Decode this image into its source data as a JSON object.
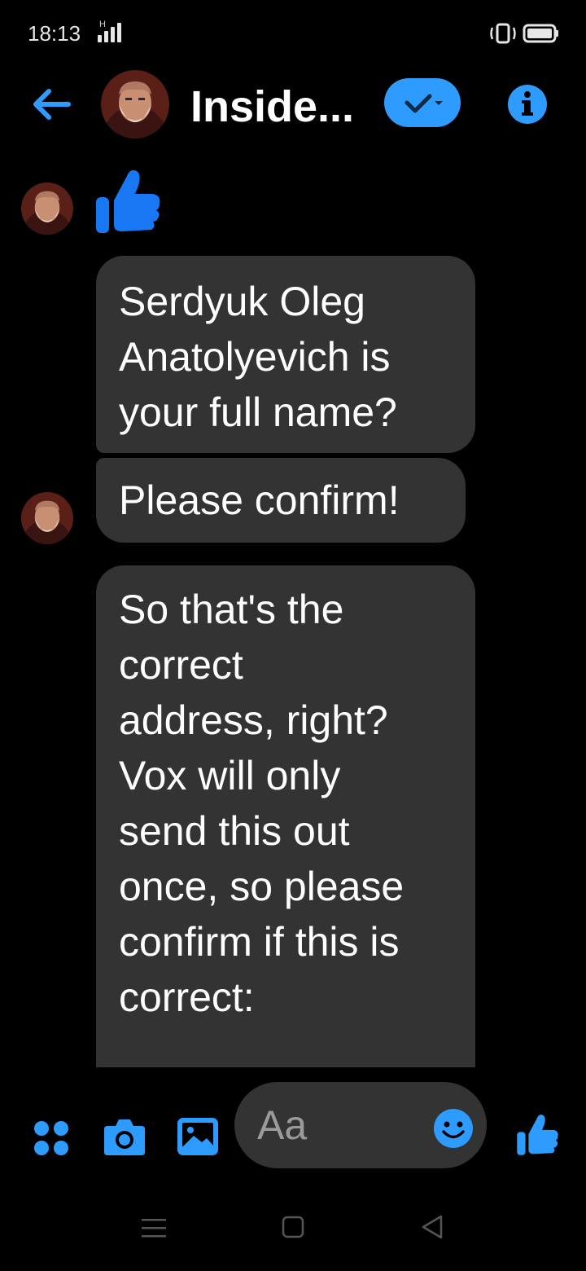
{
  "status_bar": {
    "time": "18:13",
    "network_label": "H",
    "icons": [
      "signal-icon",
      "vibrate-icon",
      "battery-icon"
    ]
  },
  "header": {
    "title": "Inside...",
    "icons": [
      "back-arrow-icon",
      "avatar",
      "check-dropdown-icon",
      "info-icon"
    ]
  },
  "messages": [
    {
      "type": "sticker",
      "icon": "thumbs-up-icon"
    },
    {
      "type": "text",
      "text_lines": [
        "Serdyuk Oleg",
        "Anatolyevich is",
        "your full name?"
      ]
    },
    {
      "type": "text",
      "text_lines": [
        "Please confirm!"
      ]
    },
    {
      "type": "text",
      "text_lines": [
        "So that's the",
        "correct",
        "address, right?",
        "Vox will only",
        "send this out",
        "once, so please",
        "confirm if this is",
        "correct:"
      ]
    }
  ],
  "composer": {
    "placeholder": "Aa",
    "icons": [
      "apps-icon",
      "camera-icon",
      "image-icon",
      "emoji-icon",
      "thumbs-up-icon"
    ]
  },
  "nav_bar": {
    "icons": [
      "menu-icon",
      "home-icon",
      "back-icon"
    ]
  },
  "colors": {
    "background": "#000000",
    "accent": "#2e9bff",
    "bubble": "#333333",
    "text": "#ffffff",
    "placeholder": "#9a9a9a"
  }
}
